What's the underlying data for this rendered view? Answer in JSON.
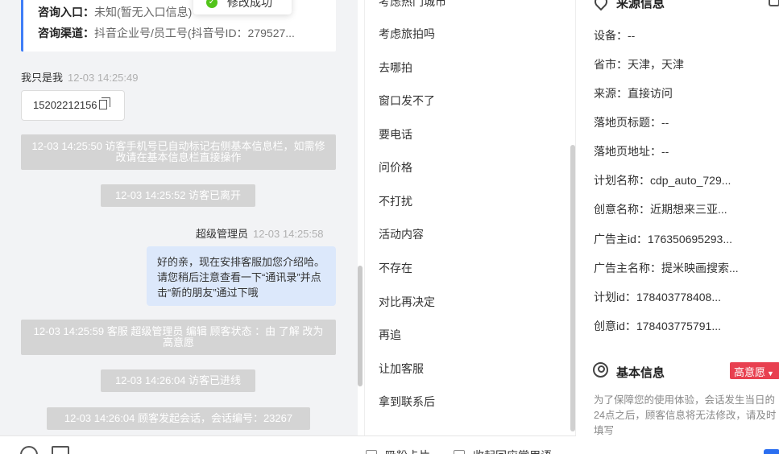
{
  "toast": {
    "text": "修改成功"
  },
  "info_card": {
    "entry_label": "咨询入口：",
    "entry_value": "未知(暂无入口信息)",
    "channel_label": "咨询渠道：",
    "channel_value": "抖音企业号/员工号(抖音号ID：279527..."
  },
  "messages": {
    "visitor_name": "我只是我",
    "visitor_time": "12-03 14:25:49",
    "phone": "15202212156",
    "sys1": "12-03 14:25:50 访客手机号已自动标记右侧基本信息栏，如需修改请在基本信息栏直接操作",
    "sys2": "12-03 14:25:52 访客已离开",
    "agent_name": "超级管理员",
    "agent_time": "12-03 14:25:58",
    "agent_text": "好的亲，现在安排客服加您介绍哈。请您稍后注意查看一下“通讯录”并点击“新的朋友”通过下哦",
    "sys3": "12-03 14:25:59 客服 超级管理员 编辑 顾客状态 ：由 了解 改为 高意愿",
    "sys4": "12-03 14:26:04 访客已进线",
    "sys5": "12-03 14:26:04 顾客发起会话，会话编号：23267"
  },
  "input_bar": {
    "option1": "吸粉卡片",
    "option2": "收起回应常用语"
  },
  "quick_replies": {
    "items": [
      "考虑热门城市",
      "考虑旅拍吗",
      "去哪拍",
      "窗口发不了",
      "要电话",
      "问价格",
      "不打扰",
      "活动内容",
      "不存在",
      "对比再决定",
      "再追",
      "让加客服",
      "拿到联系后"
    ]
  },
  "source_info": {
    "title": "来源信息",
    "rows": [
      "设备：--",
      "省市：天津，天津",
      "来源：直接访问",
      "落地页标题：--",
      "落地页地址：--",
      "计划名称：cdp_auto_729...",
      "创意名称：近期想来三亚...",
      "广告主id：176350695293...",
      "广告主名称：提米映画搜索...",
      "计划id：178403778408...",
      "创意id：178403775791..."
    ]
  },
  "basic_info": {
    "title": "基本信息",
    "badge": "高意愿",
    "notice": "为了保障您的使用体验，会话发生当日的24点之后，顾客信息将无法修改，请及时填写"
  }
}
